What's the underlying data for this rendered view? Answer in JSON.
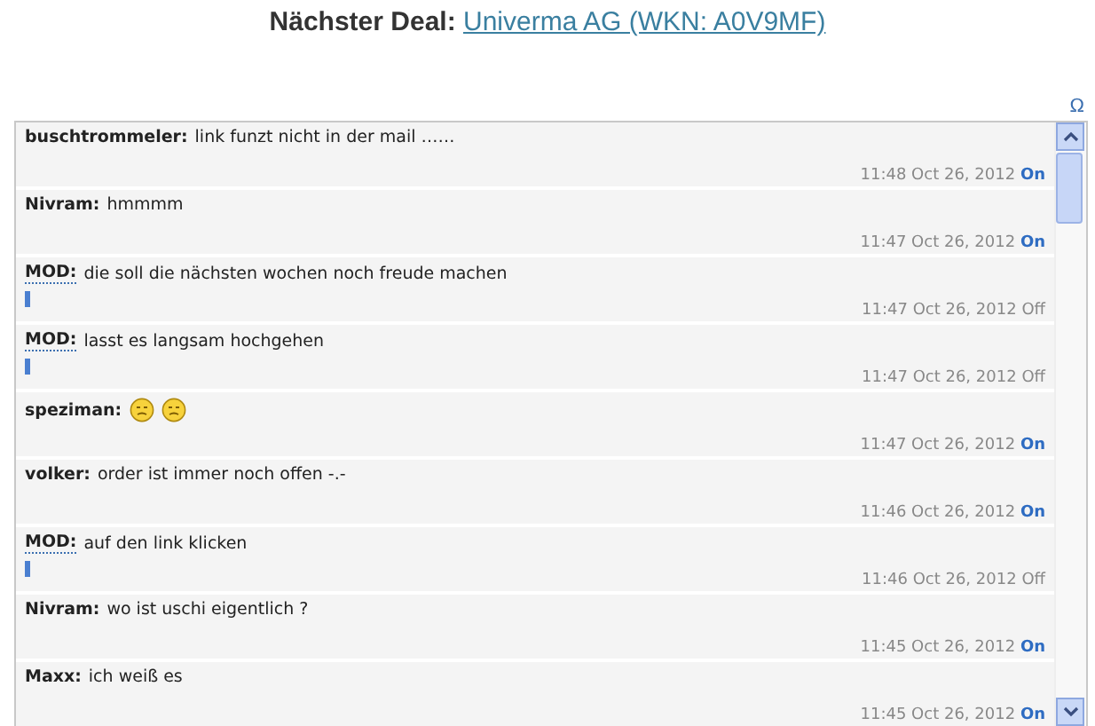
{
  "header": {
    "label": "Nächster Deal:",
    "link": "Univerma AG (WKN: A0V9MF)"
  },
  "omega": "Ω",
  "messages": [
    {
      "user": "buschtrommeler:",
      "text": "link funzt nicht in der mail ……",
      "kind": "user",
      "time": "11:48 Oct 26, 2012",
      "status": "On",
      "online": true
    },
    {
      "user": "Nivram:",
      "text": "hmmmm",
      "kind": "user",
      "time": "11:47 Oct 26, 2012",
      "status": "On",
      "online": true
    },
    {
      "user": "MOD:",
      "text": "die soll die nächsten wochen noch freude machen",
      "kind": "mod",
      "time": "11:47 Oct 26, 2012",
      "status": "Off",
      "online": false
    },
    {
      "user": "MOD:",
      "text": "lasst es langsam hochgehen",
      "kind": "mod",
      "time": "11:47 Oct 26, 2012",
      "status": "Off",
      "online": false
    },
    {
      "user": "speziman:",
      "attachments": [
        {
          "kind": "smiley"
        },
        {
          "kind": "smiley"
        }
      ],
      "kind": "user",
      "time": "11:47 Oct 26, 2012",
      "status": "On",
      "online": true
    },
    {
      "user": "volker:",
      "text": "order ist immer noch offen -.-",
      "kind": "user",
      "time": "11:46 Oct 26, 2012",
      "status": "On",
      "online": true
    },
    {
      "user": "MOD:",
      "text": "auf den link klicken",
      "kind": "mod",
      "time": "11:46 Oct 26, 2012",
      "status": "Off",
      "online": false
    },
    {
      "user": "Nivram:",
      "text": "wo ist uschi eigentlich ?",
      "kind": "user",
      "time": "11:45 Oct 26, 2012",
      "status": "On",
      "online": true
    },
    {
      "user": "Maxx:",
      "text": "ich weiß es",
      "kind": "user",
      "time": "11:45 Oct 26, 2012",
      "status": "On",
      "online": true
    }
  ]
}
